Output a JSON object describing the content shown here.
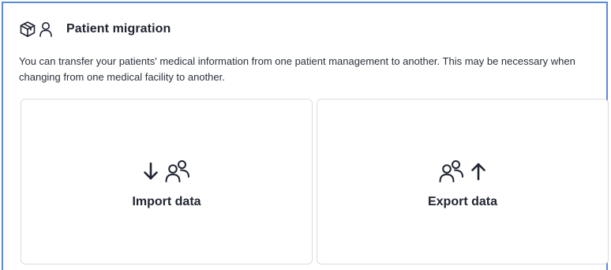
{
  "section": {
    "title": "Patient migration",
    "description": "You can transfer your patients' medical information from one patient management to another. This may be necessary when changing from one medical facility to another.",
    "icons": [
      "package-icon",
      "person-icon"
    ]
  },
  "cards": [
    {
      "label": "Import data",
      "icons": [
        "arrow-down-icon",
        "users-icon"
      ]
    },
    {
      "label": "Export data",
      "icons": [
        "users-icon",
        "arrow-up-icon"
      ]
    }
  ],
  "colors": {
    "border_accent": "#5b8ad6",
    "card_border": "#d9dce2",
    "text_primary": "#1f2430"
  }
}
